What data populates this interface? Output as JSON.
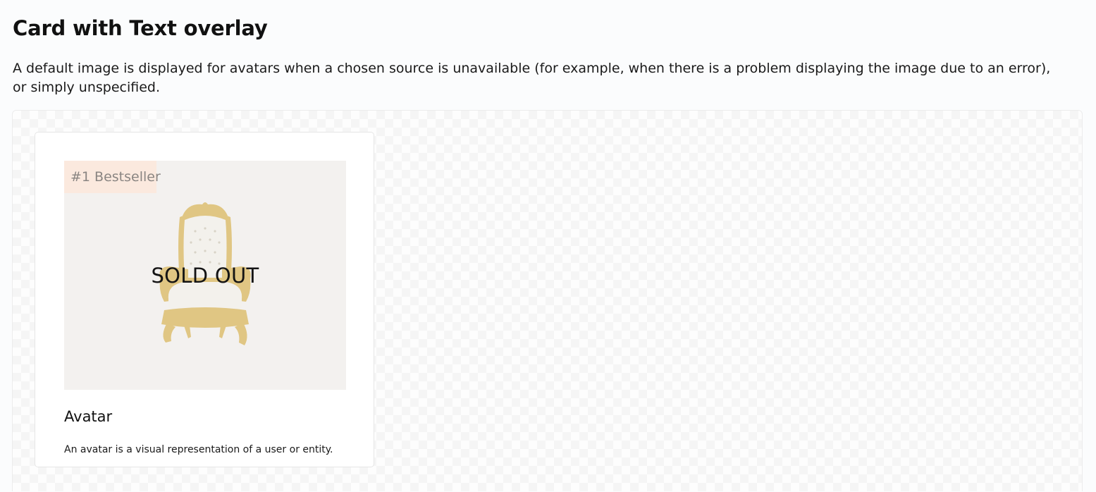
{
  "page": {
    "title": "Card with Text overlay",
    "description": "A default image is displayed for avatars when a chosen source is unavailable (for example, when there is a problem displaying the image due to an error), or simply unspecified."
  },
  "card": {
    "image": {
      "subject": "throne-chair",
      "badge": "#1 Bestseller",
      "overlay_text": "SOLD OUT"
    },
    "title": "Avatar",
    "body": "An avatar is a visual representation of a user or entity."
  },
  "colors": {
    "page_background": "#fbfcfd",
    "image_background": "#f3f1ef",
    "badge_background": "#fbe9de",
    "badge_text": "#8a8582",
    "chair_gold": "#d9b65a",
    "chair_upholstery": "#f4f2ec"
  }
}
